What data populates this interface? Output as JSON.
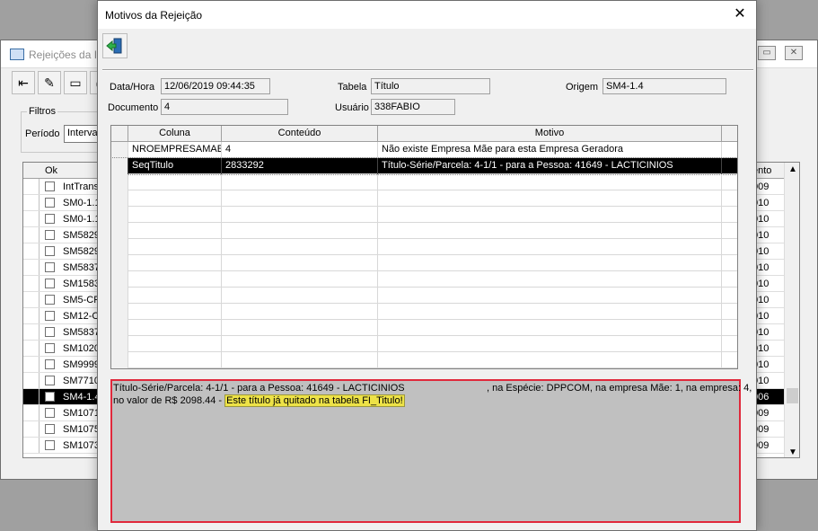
{
  "bg": {
    "title": "Rejeições da In",
    "filters_legend": "Filtros",
    "period_label": "Período",
    "period_value": "Interval",
    "ok_header": "Ok",
    "right_header": "ento",
    "rows": [
      {
        "name": "IntTrans",
        "right": "009"
      },
      {
        "name": "SM0-1.1",
        "right": "010"
      },
      {
        "name": "SM0-1.1",
        "right": "010"
      },
      {
        "name": "SM5829",
        "right": "010"
      },
      {
        "name": "SM5829",
        "right": "010"
      },
      {
        "name": "SM5837",
        "right": "010"
      },
      {
        "name": "SM1583",
        "right": "010"
      },
      {
        "name": "SM5-CF",
        "right": "010"
      },
      {
        "name": "SM12-C",
        "right": "010"
      },
      {
        "name": "SM5837",
        "right": "010"
      },
      {
        "name": "SM1020",
        "right": "010"
      },
      {
        "name": "SM9999",
        "right": "010"
      },
      {
        "name": "SM7710",
        "right": "010"
      },
      {
        "name": "SM4-1.4",
        "right": "006"
      },
      {
        "name": "SM1071",
        "right": "009"
      },
      {
        "name": "SM1075",
        "right": "009"
      },
      {
        "name": "SM1073",
        "right": "009"
      }
    ]
  },
  "dialog": {
    "title": "Motivos da Rejeição",
    "close": "✕",
    "datahora_label": "Data/Hora",
    "datahora_value": "12/06/2019  09:44:35",
    "tabela_label": "Tabela",
    "tabela_value": "Título",
    "origem_label": "Origem",
    "origem_value": "SM4-1.4",
    "documento_label": "Documento",
    "documento_value": "4",
    "usuario_label": "Usuário",
    "usuario_value": "338FABIO",
    "grid": {
      "headers": [
        "Coluna",
        "Conteúdo",
        "Motivo"
      ],
      "rows": [
        {
          "coluna": "NROEMPRESAMAE",
          "conteudo": "4",
          "motivo": "Não existe Empresa Mãe para esta Empresa Geradora"
        },
        {
          "coluna": "SeqTitulo",
          "conteudo": "2833292",
          "motivo": "Título-Série/Parcela: 4-1/1 - para a Pessoa: 41649 - LACTICINIOS"
        }
      ]
    },
    "detail": {
      "line1_a": "Título-Série/Parcela: 4-1/1 - para a Pessoa: 41649 - LACTICINIOS",
      "line1_b": ", na Espécie: DPPCOM, na empresa Mãe: 1, na empresa: 4,",
      "line2_prefix": "no valor de R$ 2098.44 - ",
      "line2_highlight": "Este título já quitado na tabela FI_Titulo!"
    }
  }
}
